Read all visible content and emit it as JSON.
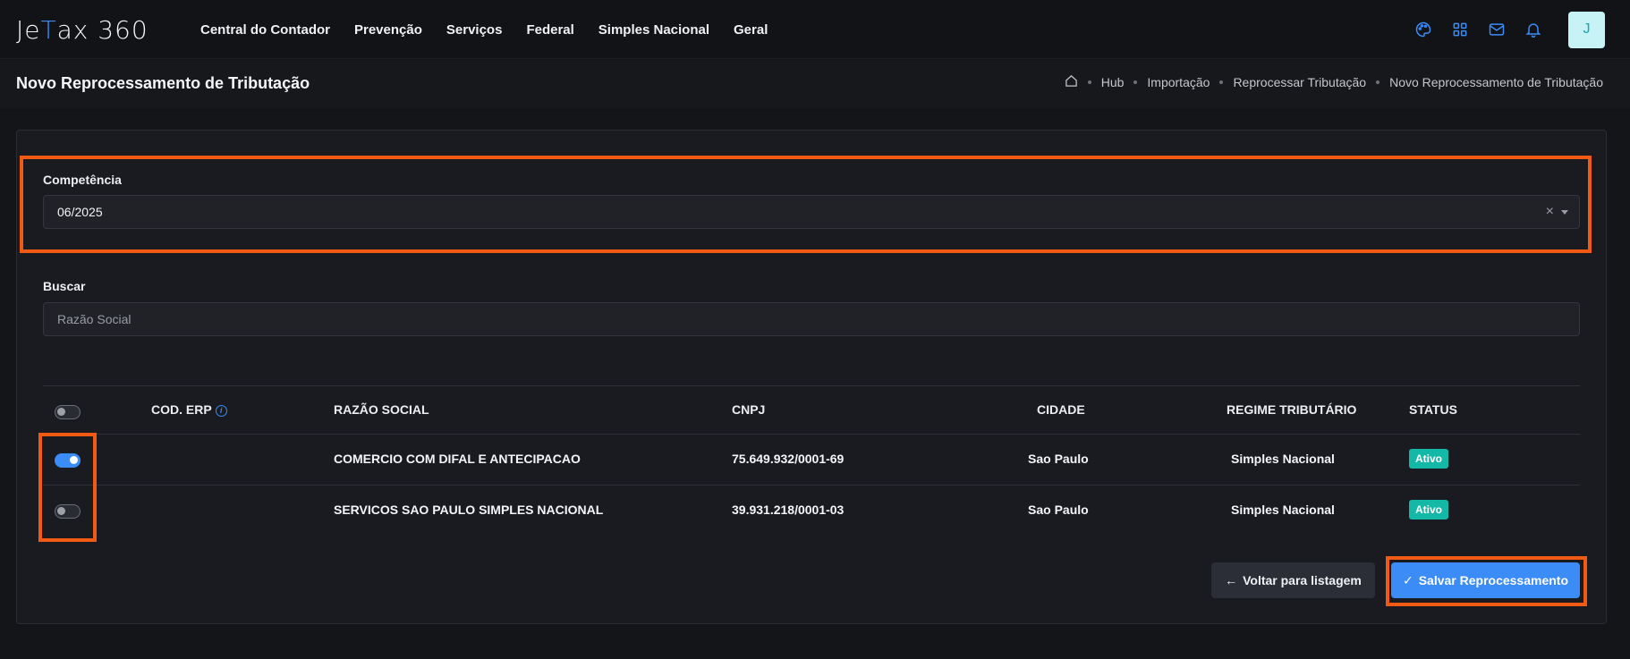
{
  "logo": {
    "text": "Je",
    "accent": "T",
    "rest": "ax 360"
  },
  "nav": {
    "items": [
      "Central do Contador",
      "Prevenção",
      "Serviços",
      "Federal",
      "Simples Nacional",
      "Geral"
    ]
  },
  "user": {
    "avatar_initial": "J"
  },
  "icons": {
    "palette": "palette-icon",
    "apps": "apps-grid-icon",
    "mail": "mail-icon",
    "bell": "bell-icon",
    "home": "home-icon",
    "info": "info-icon"
  },
  "page": {
    "title": "Novo Reprocessamento de Tributação"
  },
  "breadcrumb": [
    "Hub",
    "Importação",
    "Reprocessar Tributação",
    "Novo Reprocessamento de Tributação"
  ],
  "form": {
    "competencia": {
      "label": "Competência",
      "value": "06/2025",
      "clear": "×"
    },
    "buscar": {
      "label": "Buscar",
      "placeholder": "Razão Social"
    }
  },
  "table": {
    "headers": {
      "cod_erp": "COD. ERP",
      "info_glyph": "i",
      "razao_social": "RAZÃO SOCIAL",
      "cnpj": "CNPJ",
      "cidade": "CIDADE",
      "regime": "REGIME TRIBUTÁRIO",
      "status": "STATUS"
    },
    "select_all_checked": false,
    "rows": [
      {
        "selected": true,
        "cod_erp": "",
        "razao_social": "COMERCIO COM DIFAL E ANTECIPACAO",
        "cnpj": "75.649.932/0001-69",
        "cidade": "Sao Paulo",
        "regime": "Simples Nacional",
        "status": "Ativo"
      },
      {
        "selected": false,
        "cod_erp": "",
        "razao_social": "SERVICOS SAO PAULO SIMPLES NACIONAL",
        "cnpj": "39.931.218/0001-03",
        "cidade": "Sao Paulo",
        "regime": "Simples Nacional",
        "status": "Ativo"
      }
    ]
  },
  "actions": {
    "back": {
      "icon": "←",
      "label": "Voltar para listagem"
    },
    "save": {
      "icon": "✓",
      "label": "Salvar Reprocessamento"
    }
  },
  "colors": {
    "accent": "#3b8cf6",
    "highlight": "#f05a14",
    "badge": "#14b8a6"
  }
}
